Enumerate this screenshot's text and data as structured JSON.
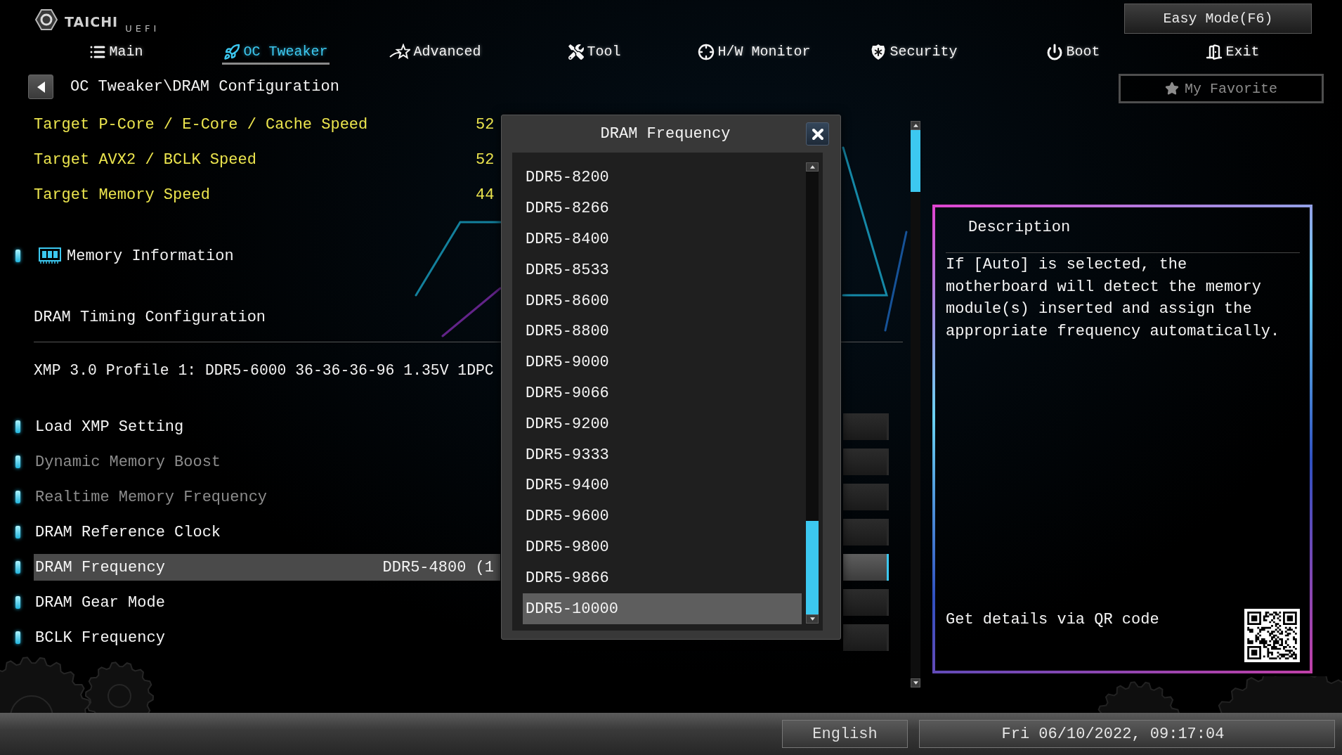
{
  "logo": {
    "brand": "TAICHI",
    "suffix": "UEFI"
  },
  "easy_mode_button": {
    "label": "Easy Mode(F6)"
  },
  "tabs": [
    {
      "label": "Main",
      "selected": false
    },
    {
      "label": "OC Tweaker",
      "selected": true
    },
    {
      "label": "Advanced",
      "selected": false
    },
    {
      "label": "Tool",
      "selected": false
    },
    {
      "label": "H/W Monitor",
      "selected": false
    },
    {
      "label": "Security",
      "selected": false
    },
    {
      "label": "Boot",
      "selected": false
    },
    {
      "label": "Exit",
      "selected": false
    }
  ],
  "my_favorite_button": {
    "label": "My Favorite"
  },
  "breadcrumb": {
    "path": "OC Tweaker\\DRAM Configuration"
  },
  "targets": [
    {
      "label": "Target P-Core / E-Core / Cache Speed",
      "value": "52"
    },
    {
      "label": "Target AVX2 / BCLK Speed",
      "value": "52"
    },
    {
      "label": "Target Memory Speed",
      "value": "44"
    }
  ],
  "menu": [
    {
      "kind": "submenu",
      "label": "Memory Information"
    },
    {
      "kind": "section",
      "label": "DRAM Timing Configuration"
    },
    {
      "kind": "info",
      "label": "XMP 3.0 Profile 1: DDR5-6000 36-36-36-96 1.35V 1DPC"
    },
    {
      "kind": "option",
      "label": "Load XMP Setting",
      "disabled": false,
      "selected": false
    },
    {
      "kind": "option",
      "label": "Dynamic Memory Boost",
      "disabled": true,
      "selected": false
    },
    {
      "kind": "option",
      "label": "Realtime Memory Frequency",
      "disabled": true,
      "selected": false
    },
    {
      "kind": "option",
      "label": "DRAM Reference Clock",
      "disabled": false,
      "selected": false
    },
    {
      "kind": "option",
      "label": "DRAM Frequency",
      "disabled": false,
      "selected": true,
      "value": "DDR5-4800 (1"
    },
    {
      "kind": "option",
      "label": "DRAM Gear Mode",
      "disabled": false,
      "selected": false
    },
    {
      "kind": "option",
      "label": "BCLK Frequency",
      "disabled": false,
      "selected": false
    }
  ],
  "dialog": {
    "title": "DRAM Frequency",
    "options": [
      {
        "label": "DDR5-8200",
        "selected": false
      },
      {
        "label": "DDR5-8266",
        "selected": false
      },
      {
        "label": "DDR5-8400",
        "selected": false
      },
      {
        "label": "DDR5-8533",
        "selected": false
      },
      {
        "label": "DDR5-8600",
        "selected": false
      },
      {
        "label": "DDR5-8800",
        "selected": false
      },
      {
        "label": "DDR5-9000",
        "selected": false
      },
      {
        "label": "DDR5-9066",
        "selected": false
      },
      {
        "label": "DDR5-9200",
        "selected": false
      },
      {
        "label": "DDR5-9333",
        "selected": false
      },
      {
        "label": "DDR5-9400",
        "selected": false
      },
      {
        "label": "DDR5-9600",
        "selected": false
      },
      {
        "label": "DDR5-9800",
        "selected": false
      },
      {
        "label": "DDR5-9866",
        "selected": false
      },
      {
        "label": "DDR5-10000",
        "selected": true
      }
    ]
  },
  "description": {
    "title": "Description",
    "text": "If [Auto] is selected, the motherboard will detect the memory module(s) inserted and assign the appropriate frequency automatically.",
    "qr_caption": "Get details via QR code"
  },
  "status_bar": {
    "language": "English",
    "datetime": "Fri 06/10/2022, 09:17:04"
  }
}
